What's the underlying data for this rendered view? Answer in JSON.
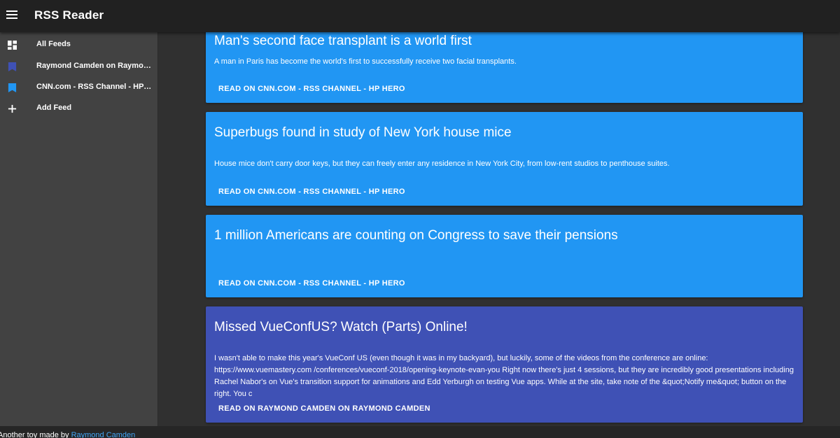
{
  "app": {
    "title": "RSS Reader",
    "menu_icon": "hamburger-menu-icon"
  },
  "drawer": {
    "items": [
      {
        "label": "All Feeds",
        "icon": "dashboard-icon"
      },
      {
        "label": "Raymond Camden on Raymond Camden",
        "icon": "bookmark-icon",
        "color": "#3f51b5"
      },
      {
        "label": "CNN.com - RSS Channel - HP Hero",
        "icon": "bookmark-icon",
        "color": "#2196f3"
      },
      {
        "label": "Add Feed",
        "icon": "plus-icon"
      }
    ]
  },
  "cards": [
    {
      "title": "Man's second face transplant is a world first",
      "description": "A man in Paris has become the world's first to successfully receive two facial transplants.",
      "action": "READ ON CNN.COM - RSS CHANNEL - HP HERO",
      "color": "#2196f3"
    },
    {
      "title": "Superbugs found in study of New York house mice",
      "description": "House mice don't carry door keys, but they can freely enter any residence in New York City, from low-rent studios to penthouse suites.",
      "action": "READ ON CNN.COM - RSS CHANNEL - HP HERO",
      "color": "#2196f3"
    },
    {
      "title": "1 million Americans are counting on Congress to save their pensions",
      "description": "",
      "action": "READ ON CNN.COM - RSS CHANNEL - HP HERO",
      "color": "#2196f3"
    },
    {
      "title": "Missed VueConfUS? Watch (Parts) Online!",
      "description": "I wasn't able to make this year's VueConf US (even though it was in my backyard), but luckily, some of the videos from the conference are online: https://www.vuemastery.com /conferences/vueconf-2018/opening-keynote-evan-you Right now there's just 4 sessions, but they are incredibly good presentations including Rachel Nabor's on Vue's transition support for animations and Edd Yerburgh on testing Vue apps. While at the site, take note of the &quot;Notify me&quot; button on the right. You c",
      "action": "READ ON RAYMOND CAMDEN ON RAYMOND CAMDEN",
      "color": "#3f51b5"
    }
  ],
  "footer": {
    "text": "Another toy made by",
    "link": "Raymond Camden",
    "link_color": "#42a5f5"
  }
}
